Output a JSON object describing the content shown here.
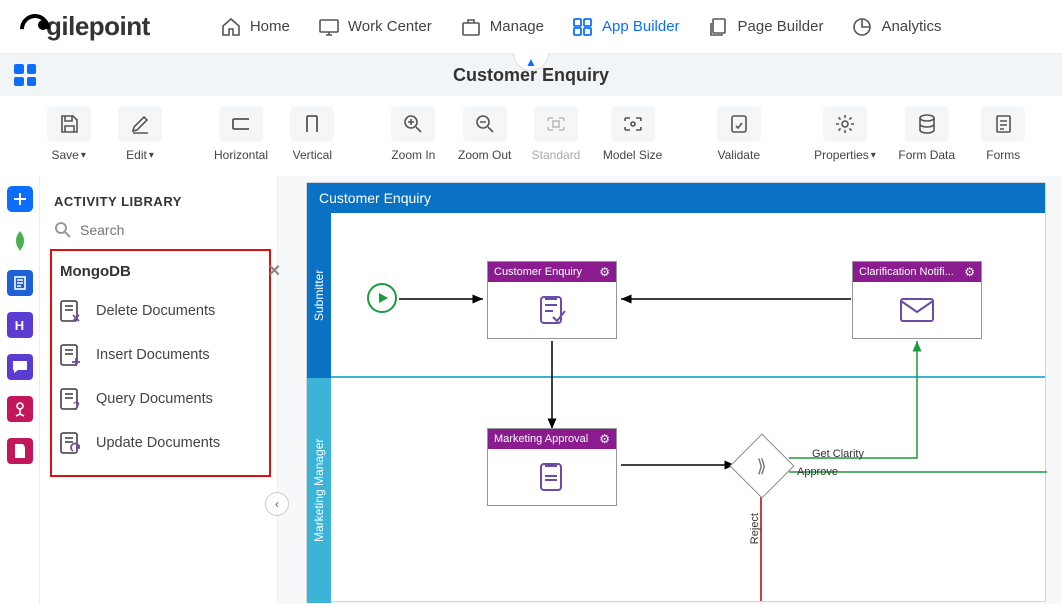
{
  "logo_text": "gilepoint",
  "nav": {
    "home": "Home",
    "work_center": "Work Center",
    "manage": "Manage",
    "app_builder": "App Builder",
    "page_builder": "Page Builder",
    "analytics": "Analytics"
  },
  "document_title": "Customer Enquiry",
  "toolbar": {
    "save": "Save",
    "edit": "Edit",
    "horizontal": "Horizontal",
    "vertical": "Vertical",
    "zoom_in": "Zoom In",
    "zoom_out": "Zoom Out",
    "standard": "Standard",
    "model_size": "Model Size",
    "validate": "Validate",
    "properties": "Properties",
    "form_data": "Form Data",
    "forms": "Forms"
  },
  "sidepanel": {
    "title": "ACTIVITY LIBRARY",
    "search_placeholder": "Search",
    "category": "MongoDB",
    "items": [
      "Delete Documents",
      "Insert Documents",
      "Query Documents",
      "Update Documents"
    ]
  },
  "canvas": {
    "title": "Customer Enquiry",
    "lanes": [
      "Submitter",
      "Marketing Manager"
    ],
    "nodes": {
      "customer_enquiry": "Customer Enquiry",
      "clarification": "Clarification Notifi...",
      "marketing_approval": "Marketing Approval"
    },
    "edges": {
      "get_clarity": "Get Clarity",
      "approve": "Approve",
      "reject": "Reject"
    }
  }
}
